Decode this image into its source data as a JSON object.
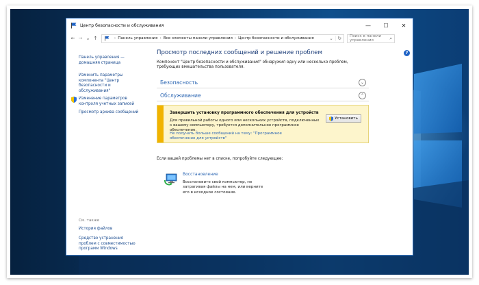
{
  "window": {
    "title": "Центр безопасности и обслуживания",
    "controls": {
      "minimize": "—",
      "maximize": "☐",
      "close": "✕"
    }
  },
  "addressbar": {
    "back": "←",
    "forward": "→",
    "dropdown": "⌄",
    "up": "↑",
    "breadcrumbs": [
      "Панель управления",
      "Все элементы панели управления",
      "Центр безопасности и обслуживания"
    ],
    "separator": "›",
    "search_placeholder": "Поиск в панели управления"
  },
  "sidebar": {
    "links": [
      {
        "label": "Панель управления — домашняя страница"
      },
      {
        "label": "Изменить параметры компонента \"Центр безопасности и обслуживания\""
      },
      {
        "label": "Изменение параметров контроля учетных записей"
      },
      {
        "label": "Просмотр архива сообщений"
      }
    ],
    "see_also": {
      "heading": "См. также",
      "links": [
        {
          "label": "История файлов"
        },
        {
          "label": "Средство устранения проблем с совместимостью программ Windows"
        }
      ]
    }
  },
  "main": {
    "heading": "Просмотр последних сообщений и решение проблем",
    "intro": "Компонент \"Центр безопасности и обслуживания\" обнаружил одну или несколько проблем, требующих вмешательства пользователя.",
    "sections": [
      {
        "label": "Безопасность",
        "expanded": false
      },
      {
        "label": "Обслуживание",
        "expanded": true
      }
    ],
    "alert": {
      "title": "Завершить установку программного обеспечения для устройств",
      "text": "Для правильной работы одного или нескольких устройств, подключенных к вашему компьютеру, требуется дополнительное программное обеспечение.",
      "link": "Не получать больше сообщений на тему: \"Программное обеспечение для устройств\"",
      "button": "Установить",
      "stripe_color": "#f1b300"
    },
    "try_text": "Если вашей проблемы нет в списке, попробуйте следующее:",
    "recovery": {
      "title": "Восстановление",
      "desc": "Восстановите свой компьютер, не затрагивая файлы на нем, или верните его в исходное состояние."
    },
    "help": "?"
  },
  "colors": {
    "link": "#2d67b3",
    "heading": "#1e3f7a",
    "accent": "#1f63c6",
    "window_border": "#3a7bc8"
  }
}
